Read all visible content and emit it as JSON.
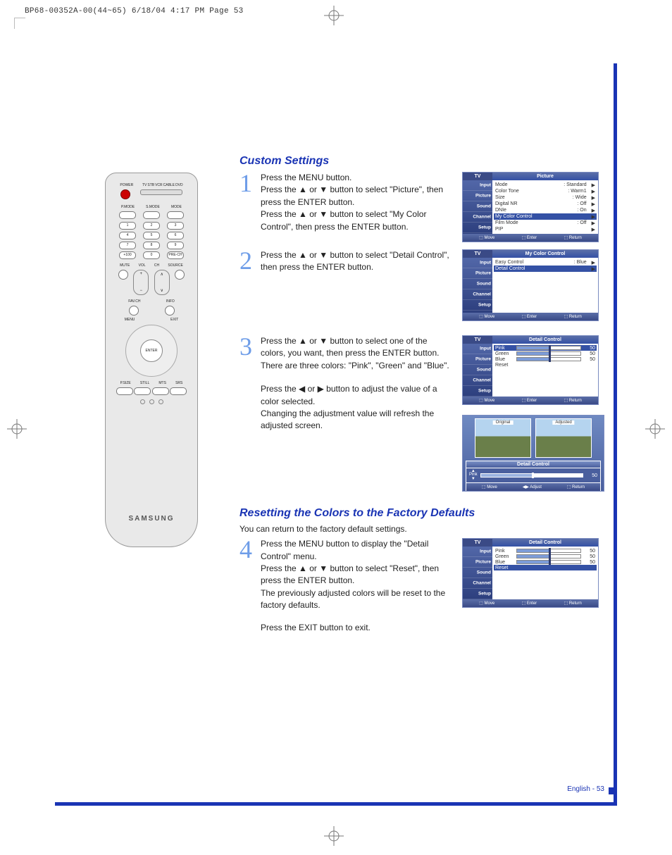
{
  "print_header": "BP68-00352A-00(44~65)  6/18/04  4:17 PM  Page 53",
  "remote": {
    "brand": "SAMSUNG",
    "top_labels": [
      "POWER",
      "TV",
      "STB",
      "VCR",
      "CABLE",
      "DVD"
    ],
    "mode_labels": [
      "P.MODE",
      "S.MODE",
      "MODE"
    ],
    "numpad": [
      "1",
      "2",
      "3",
      "4",
      "5",
      "6",
      "7",
      "8",
      "9",
      "+100",
      "0",
      "PRE-CH"
    ],
    "mid_labels": [
      "MUTE",
      "VOL",
      "CH",
      "SOURCE"
    ],
    "nav_labels": [
      "FAV.CH",
      "INFO",
      "MENU",
      "EXIT",
      "ENTER"
    ],
    "bottom_labels": [
      "P.SIZE",
      "STILL",
      "MTS",
      "SRS"
    ]
  },
  "sections": {
    "custom": {
      "heading": "Custom Settings",
      "steps": {
        "1": "Press the MENU button.\nPress the ▲ or ▼ button to select \"Picture\", then press the ENTER button.\nPress the ▲ or ▼ button to select \"My Color Control\", then press the ENTER button.",
        "2": "Press the ▲ or ▼ button to select \"Detail Control\", then press the ENTER button.",
        "3": "Press the ▲ or ▼ button to select one of the colors, you want, then press the ENTER button.\nThere are three colors: \"Pink\", \"Green\" and \"Blue\".",
        "3b": "Press the ◀ or ▶ button to adjust the value of a color selected.\nChanging the adjustment value will refresh the adjusted screen."
      }
    },
    "reset": {
      "heading": "Resetting the Colors to the Factory Defaults",
      "sub": "You can return to the factory default settings.",
      "steps": {
        "4": "Press the MENU button to display the \"Detail Control\" menu.\nPress the ▲ or ▼ button to select \"Reset\", then press the ENTER button.\nThe previously adjusted colors will be reset to the factory defaults.",
        "4b": "Press the EXIT button to exit."
      }
    }
  },
  "menus": {
    "side_items": [
      "Input",
      "Picture",
      "Sound",
      "Channel",
      "Setup"
    ],
    "tv_label": "TV",
    "footer_move": "Move",
    "footer_enter": "Enter",
    "footer_return": "Return",
    "footer_adjust": "Adjust",
    "picture": {
      "title": "Picture",
      "rows": [
        [
          "Mode",
          ": Standard"
        ],
        [
          "Color Tone",
          ": Warm1"
        ],
        [
          "Size",
          ": Wide"
        ],
        [
          "Digital NR",
          ": Off"
        ],
        [
          "DNIe",
          ": On"
        ],
        [
          "My Color Control",
          ""
        ],
        [
          "Film Mode",
          ": Off"
        ],
        [
          "PIP",
          ""
        ]
      ],
      "highlight": 5
    },
    "mycolor": {
      "title": "My Color Control",
      "rows": [
        [
          "Easy Control",
          ": Blue"
        ],
        [
          "Detail Control",
          ""
        ]
      ],
      "highlight": 1
    },
    "detail1": {
      "title": "Detail Control",
      "sliders": [
        [
          "Pink",
          "50"
        ],
        [
          "Green",
          "50"
        ],
        [
          "Blue",
          "50"
        ]
      ],
      "extra_row": "Reset",
      "highlight": 0
    },
    "detail2": {
      "title": "Detail Control",
      "sliders": [
        [
          "Pink",
          "50"
        ],
        [
          "Green",
          "50"
        ],
        [
          "Blue",
          "50"
        ]
      ],
      "extra_row": "Reset",
      "highlight": 3
    },
    "preview": {
      "title": "Detail Control",
      "left_label": "Original",
      "right_label": "Adjusted",
      "slider_label": "Pink",
      "slider_value": "50"
    }
  },
  "page_footer": "English - 53"
}
